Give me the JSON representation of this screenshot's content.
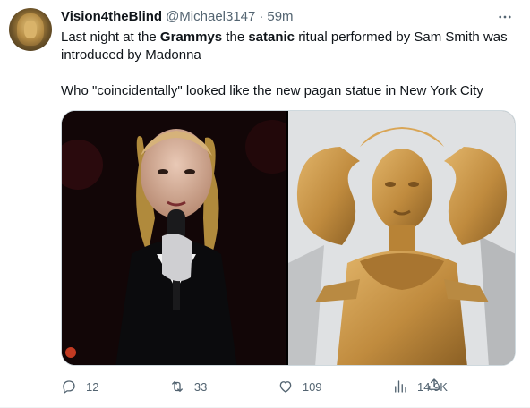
{
  "tweet": {
    "author_name": "Vision4theBlind",
    "handle": "@Michael3147",
    "separator": "·",
    "time": "59m",
    "line1_part1": "Last night at the ",
    "line1_bold1": "Grammys",
    "line1_part2": " the ",
    "line1_bold2": "satanic",
    "line1_part3": " ritual performed by Sam Smith was introduced by Madonna",
    "line2": "Who \"coincidentally\" looked like the new pagan statue in New York City"
  },
  "actions": {
    "reply_count": "12",
    "retweet_count": "33",
    "like_count": "109",
    "views_count": "14.9K"
  },
  "icons": {
    "more": "more-icon",
    "reply": "reply-icon",
    "retweet": "retweet-icon",
    "like": "heart-icon",
    "views": "views-icon",
    "share": "share-icon"
  },
  "colors": {
    "text": "#0f1419",
    "secondary": "#536471",
    "border": "#cfd9de"
  }
}
